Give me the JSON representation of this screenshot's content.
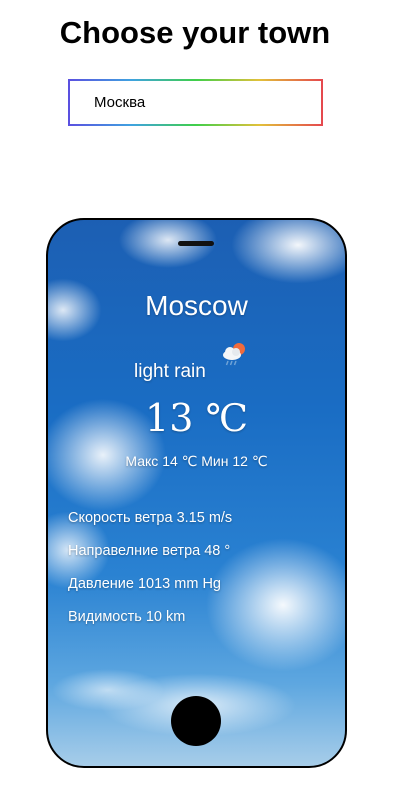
{
  "page": {
    "heading": "Choose your town"
  },
  "search": {
    "value": "Москва",
    "placeholder": ""
  },
  "weather": {
    "city": "Moscow",
    "description": "light rain",
    "icon": "rain-cloud-sun-icon",
    "temperature": "13 ℃",
    "min_max": "Макс 14 ℃ Мин 12 ℃",
    "wind_speed": "Скорость ветра 3.15 m/s",
    "wind_direction": "Направелние ветра 48 °",
    "pressure": "Давление 1013 mm Hg",
    "visibility": "Видимость 10 km"
  },
  "colors": {
    "sky": "#1a6dc4",
    "input_border_gradient": [
      "#5b4fe0",
      "#3fa3e0",
      "#3fcf4a",
      "#e2c13a",
      "#e5474e"
    ]
  }
}
